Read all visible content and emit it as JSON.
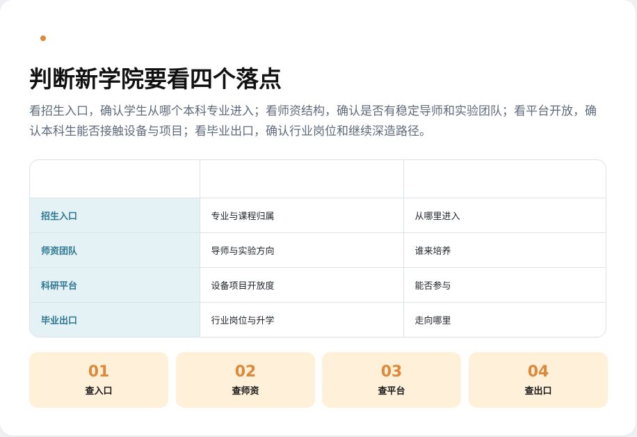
{
  "header": {
    "title": "判断新学院要看四个落点",
    "description": "看招生入口，确认学生从哪个本科专业进入；看师资结构，确认是否有稳定导师和实验团队；看平台开放，确认本科生能否接触设备与项目；看毕业出口，确认行业岗位和继续深造路径。"
  },
  "table": {
    "headers": [
      "",
      "",
      ""
    ],
    "rows": [
      {
        "label": "招生入口",
        "col2": "专业与课程归属",
        "col3": "从哪里进入"
      },
      {
        "label": "师资团队",
        "col2": "导师与实验方向",
        "col3": "谁来培养"
      },
      {
        "label": "科研平台",
        "col2": "设备项目开放度",
        "col3": "能否参与"
      },
      {
        "label": "毕业出口",
        "col2": "行业岗位与升学",
        "col3": "走向哪里"
      }
    ]
  },
  "steps": [
    {
      "num": "01",
      "label": "查入口"
    },
    {
      "num": "02",
      "label": "查师资"
    },
    {
      "num": "03",
      "label": "查平台"
    },
    {
      "num": "04",
      "label": "查出口"
    }
  ],
  "colors": {
    "accent": "#e0883a",
    "row_header_bg": "#e4f1f5",
    "row_header_text": "#2e7791",
    "step_bg": "#fff0d9"
  }
}
